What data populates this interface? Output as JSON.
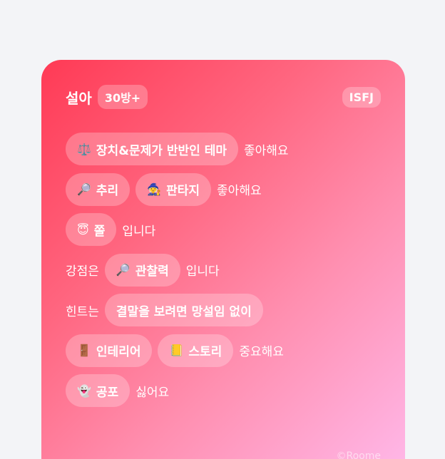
{
  "profile": {
    "nickname": "설아",
    "count_badge": "30방+",
    "mbti": "ISFJ"
  },
  "rows": [
    {
      "prefix": "",
      "chips": [
        {
          "icon": "⚖️",
          "label": "장치&문제가 반반인 테마"
        }
      ],
      "suffix": "좋아해요"
    },
    {
      "prefix": "",
      "chips": [
        {
          "icon": "🔎",
          "label": "추리"
        },
        {
          "icon": "🧙",
          "label": "판타지"
        }
      ],
      "suffix": "좋아해요"
    },
    {
      "prefix": "",
      "chips": [
        {
          "icon": "😇",
          "label": "쫄"
        }
      ],
      "suffix": "입니다"
    },
    {
      "prefix": "강점은",
      "chips": [
        {
          "icon": "🔎",
          "label": "관찰력"
        }
      ],
      "suffix": "입니다"
    },
    {
      "prefix": "힌트는",
      "chips": [
        {
          "icon": "",
          "label": "결말을 보려면 망설임 없이"
        }
      ],
      "suffix": ""
    },
    {
      "prefix": "",
      "chips": [
        {
          "icon": "🚪",
          "label": "인테리어"
        },
        {
          "icon": "📒",
          "label": "스토리"
        }
      ],
      "suffix": "중요해요"
    },
    {
      "prefix": "",
      "chips": [
        {
          "icon": "👻",
          "label": "공포"
        }
      ],
      "suffix": "싫어요"
    }
  ],
  "watermark": "©Roome"
}
